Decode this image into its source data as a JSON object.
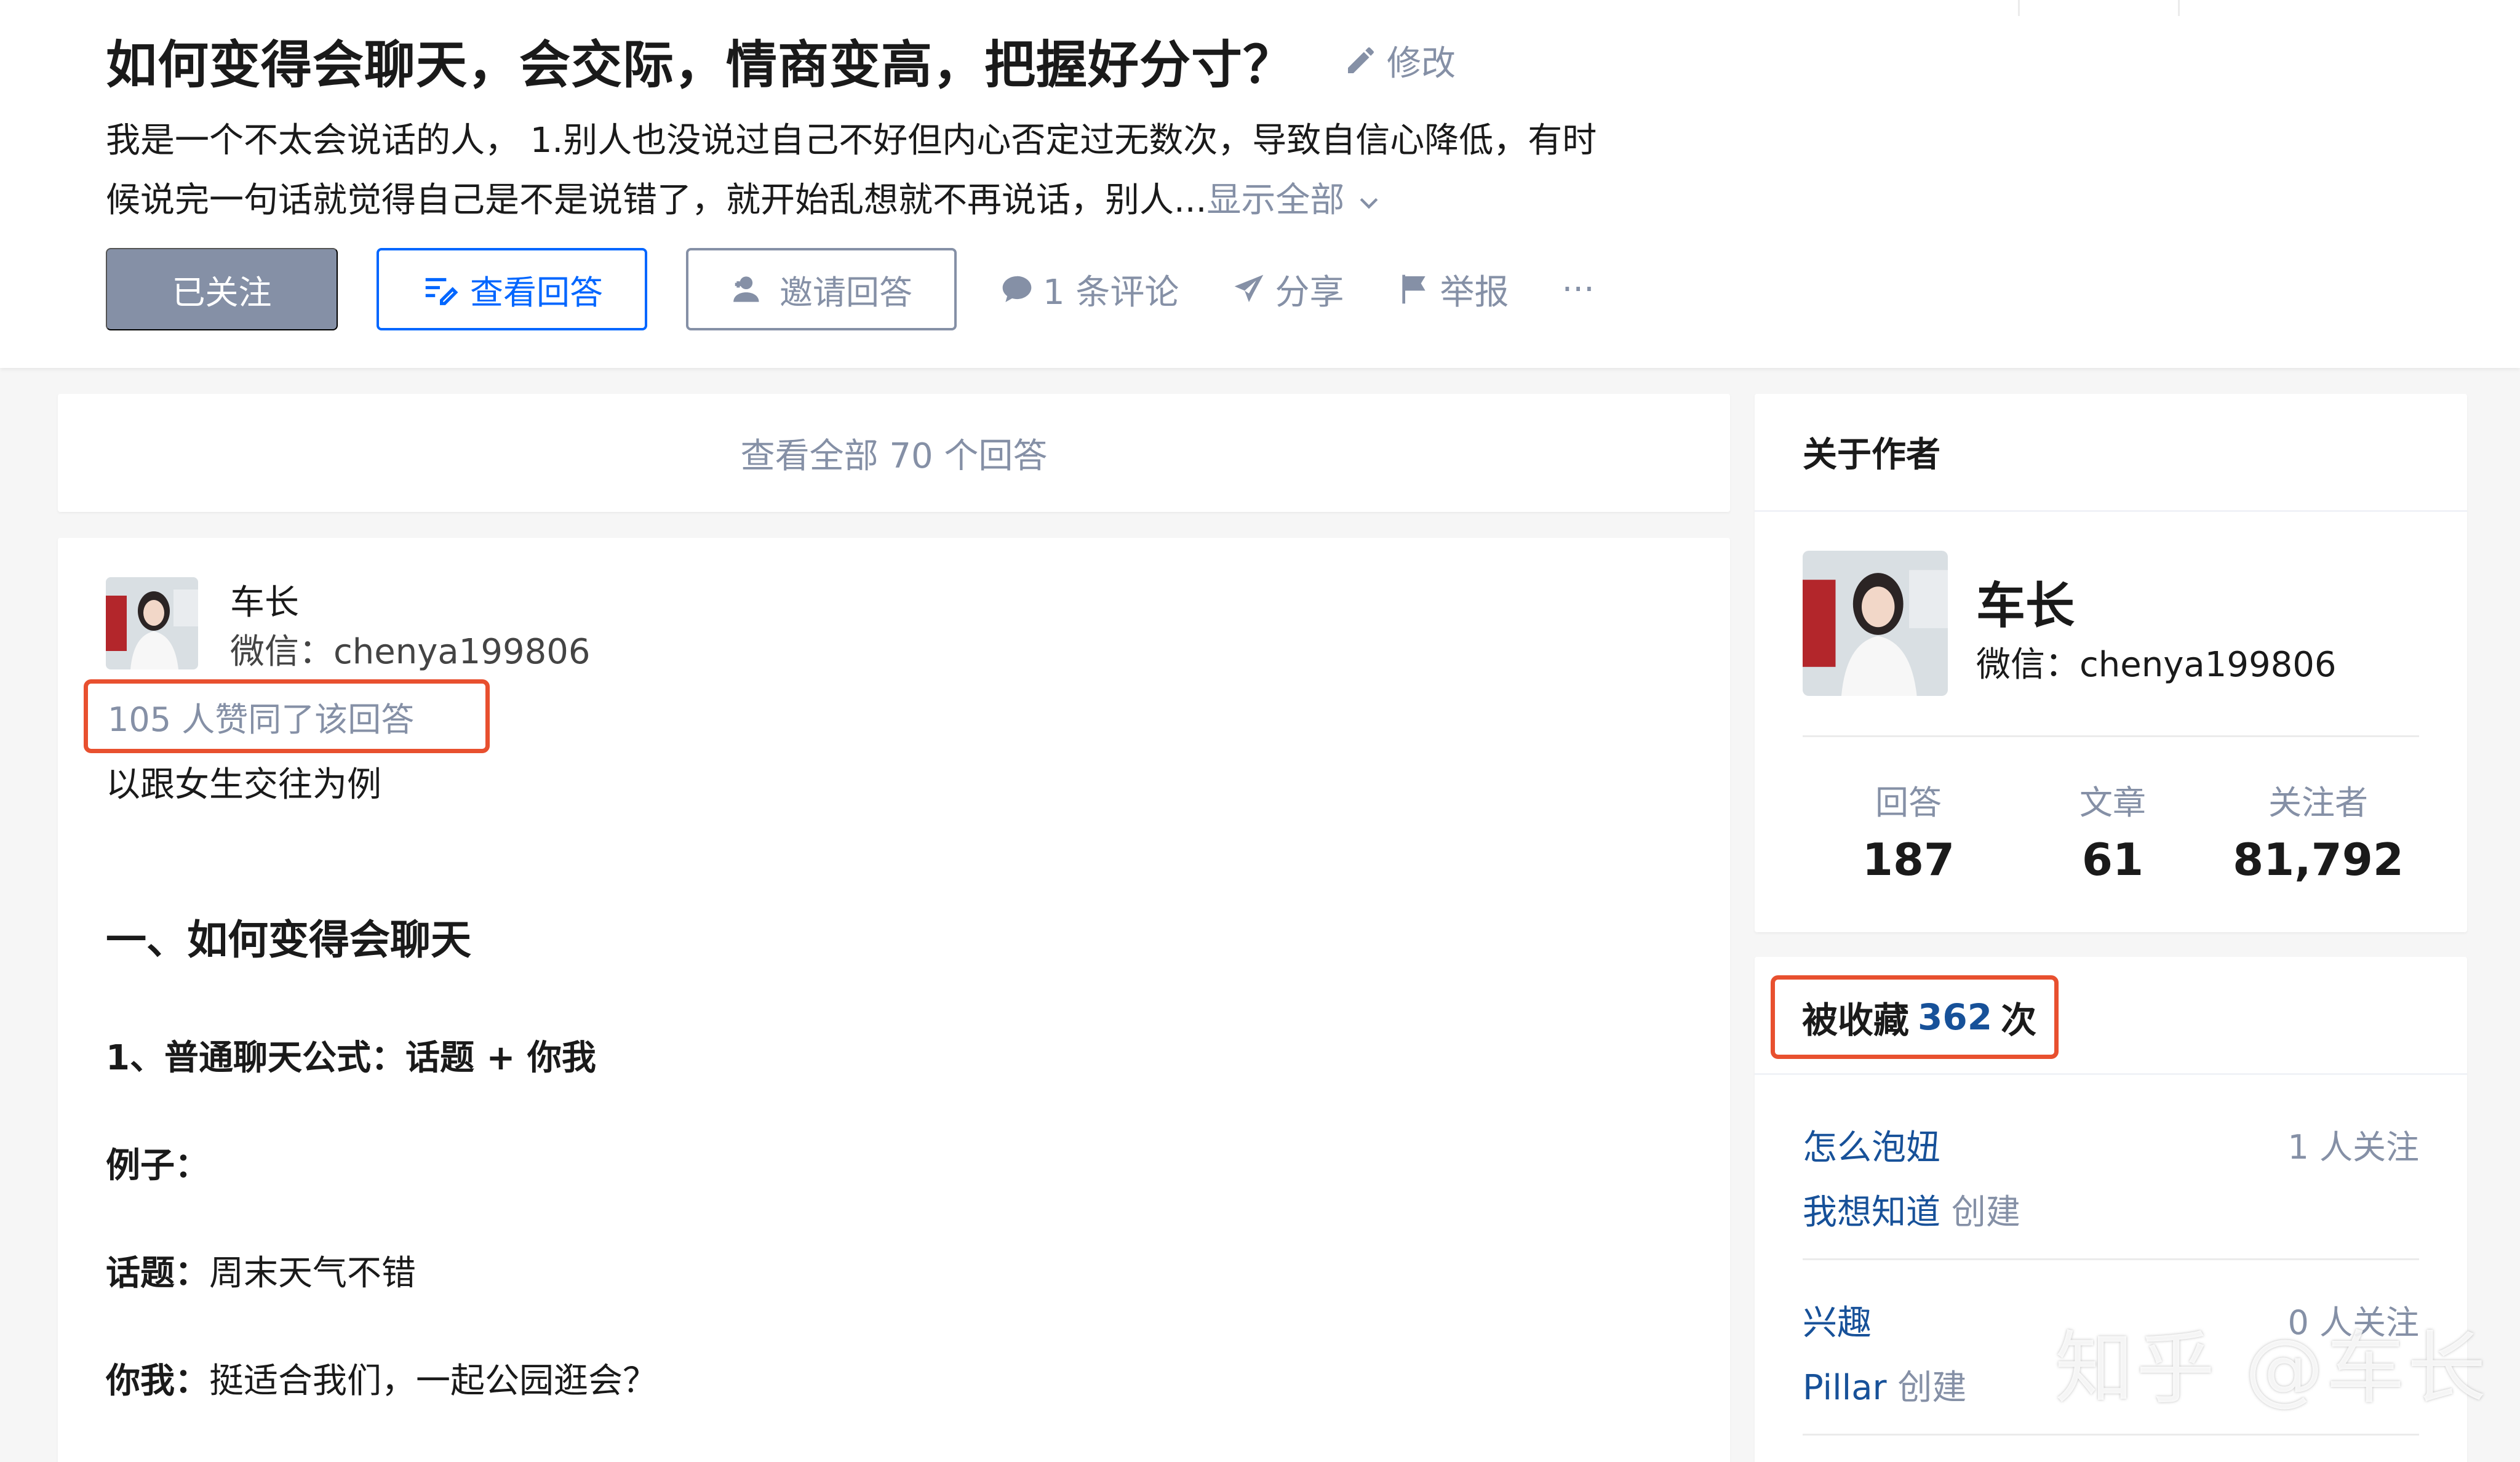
{
  "question": {
    "title": "如何变得会聊天，会交际，情商变高，把握好分寸？",
    "edit_label": "修改",
    "detail_line1": "我是一个不太会说话的人， 1.别人也没说过自己不好但内心否定过无数次，导致自信心降低，有时",
    "detail_line2": "候说完一句话就觉得自己是不是说错了，就开始乱想就不再说话，别人...",
    "show_all_label": "显示全部"
  },
  "actions": {
    "followed_label": "已关注",
    "view_answers_label": "查看回答",
    "invite_label": "邀请回答",
    "comments_label": "1 条评论",
    "share_label": "分享",
    "report_label": "举报",
    "more_label": "···"
  },
  "main": {
    "view_all_label": "查看全部 70 个回答",
    "answer": {
      "author_name": "车长",
      "author_bio": "微信：chenya199806",
      "vote_text": "105 人赞同了该回答",
      "lines": [
        {
          "text": "以跟女生交往为例",
          "style": "normal"
        },
        {
          "text": "一、如何变得会聊天",
          "style": "heading"
        },
        {
          "text": "1、普通聊天公式：话题 + 你我",
          "style": "bold"
        },
        {
          "text": "例子：",
          "style": "bold"
        }
      ],
      "topic_label": "话题：",
      "topic_value": "周末天气不错",
      "you_me_label": "你我：",
      "you_me_value": "挺适合我们，一起公园逛会？"
    }
  },
  "sidebar": {
    "about": {
      "title": "关于作者",
      "name": "车长",
      "bio": "微信：chenya199806",
      "stats": [
        {
          "label": "回答",
          "value": "187"
        },
        {
          "label": "文章",
          "value": "61"
        },
        {
          "label": "关注者",
          "value": "81,792"
        }
      ]
    },
    "collections": {
      "prefix": "被收藏",
      "count": "362",
      "suffix": "次",
      "items": [
        {
          "title": "怎么泡妞",
          "creator": "我想知道",
          "created_label": "创建",
          "followers": "1 人关注"
        },
        {
          "title": "兴趣",
          "creator": "Pillar",
          "created_label": "创建",
          "followers": "0 人关注"
        }
      ]
    }
  },
  "watermark": "知乎 @车长",
  "colors": {
    "brand_blue": "#0066ff",
    "link_blue": "#175199",
    "meta_gray": "#8590a6",
    "highlight_red": "#e8502f"
  }
}
